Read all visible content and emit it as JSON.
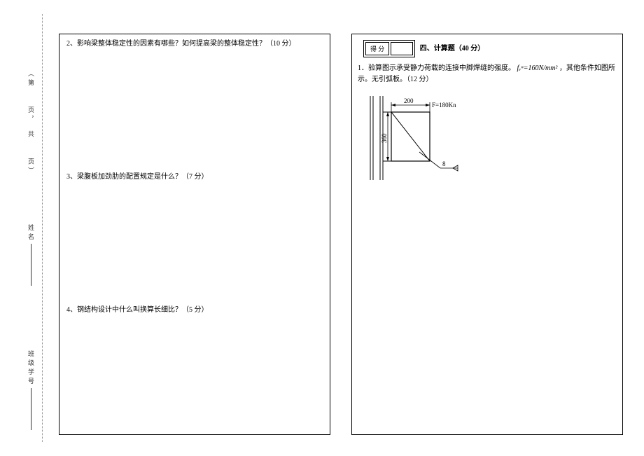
{
  "binding": {
    "page_info": "（第　　页，　共　　页）",
    "name_label": "姓名",
    "class_label": "班级学号"
  },
  "left": {
    "q2": "2、影响梁整体稳定性的因素有哪些？如何提高梁的整体稳定性？（10 分）",
    "q3": "3、梁腹板加劲肋的配置规定是什么？（7 分）",
    "q4": "4、钢结构设计中什么叫换算长细比？（5 分）"
  },
  "right": {
    "score_label": "得 分",
    "section_title": "四、计算题（40 分）",
    "q1_prefix": "1．验算图示承受静力荷载的连接中脚焊缝的强度。",
    "q1_formula_var": "fₑʷ",
    "q1_formula_val": "=160N/mm²",
    "q1_suffix": "，其他条件如图所示。无引弧板。（12 分）",
    "diagram": {
      "dim_w": "200",
      "dim_h": "360",
      "force": "F=180Kn",
      "weld": "8"
    }
  }
}
